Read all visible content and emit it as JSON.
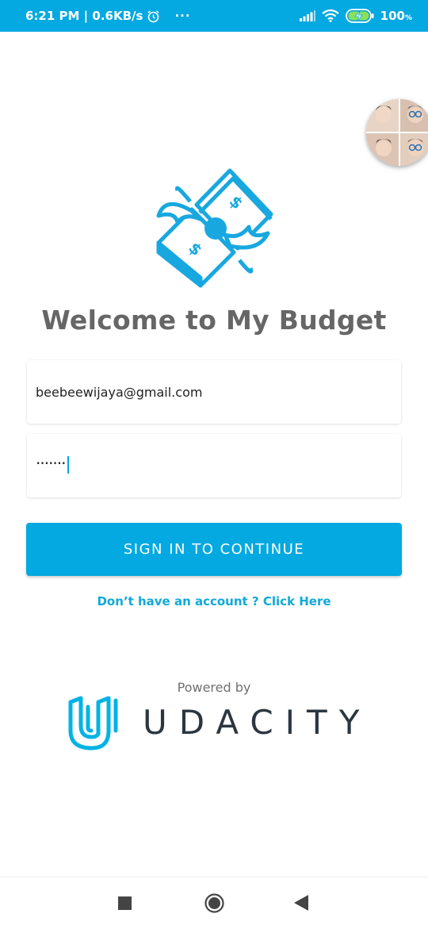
{
  "status_bar": {
    "time": "6:21 PM",
    "separator": " | ",
    "network_speed": "0.6KB/s",
    "more": "···",
    "battery_level": "100",
    "battery_unit": "%",
    "icons": [
      "alarm-icon",
      "signal-icon",
      "wifi-icon",
      "battery-charging-icon"
    ]
  },
  "app": {
    "title": "Welcome to My Budget",
    "email_value": "beebeewijaya@gmail.com",
    "password_mask": "·······",
    "signin_label": "SIGN IN TO CONTINUE",
    "register_link": "Don’t have an account ? Click Here",
    "powered_by": "Powered by",
    "brand_name": "UDACITY"
  },
  "colors": {
    "accent": "#03a9e0",
    "title_gray": "#666666",
    "link": "#12a9d9",
    "udacity_text": "#2b3640"
  },
  "nav_bar": [
    "recents-square-icon",
    "home-circle-icon",
    "back-triangle-icon"
  ]
}
